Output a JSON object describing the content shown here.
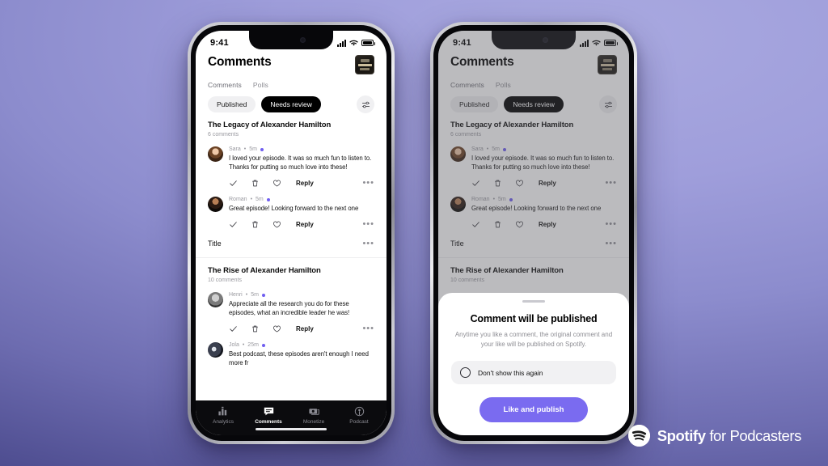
{
  "background": {
    "gradient_from": "#a9a9e0",
    "gradient_to": "#4b4a8d"
  },
  "brand": {
    "logo_mark": "spotify-icon",
    "name_bold": "Spotify",
    "name_rest": " for Podcasters",
    "accent": "#7a6bf0"
  },
  "status_bar": {
    "time": "9:41",
    "signal_icon": "cellular-bars-icon",
    "wifi_icon": "wifi-icon",
    "battery_icon": "battery-full-icon"
  },
  "header": {
    "title": "Comments",
    "cover_art": "podcast-cover-art"
  },
  "tabs": [
    {
      "label": "Comments",
      "active": true
    },
    {
      "label": "Polls",
      "active": false
    }
  ],
  "filters": {
    "chips": [
      {
        "label": "Published",
        "selected": false
      },
      {
        "label": "Needs review",
        "selected": true
      }
    ],
    "filter_icon": "sliders-filter-icon"
  },
  "episodes": [
    {
      "title": "The Legacy of Alexander Hamilton",
      "count": "6 comments",
      "comments": [
        {
          "avatar": "av-sara",
          "author": "Sara",
          "time": "5m",
          "meta_sep": "•",
          "text": "I loved your episode. It was so much fun to listen to. Thanks for putting so much love into these!",
          "actions": {
            "approve_icon": "check-icon",
            "delete_icon": "trash-icon",
            "like_icon": "heart-icon",
            "reply_label": "Reply",
            "more_icon": "more-horizontal-icon",
            "more_glyph": "•••"
          }
        },
        {
          "avatar": "av-roman",
          "author": "Roman",
          "time": "5m",
          "meta_sep": "•",
          "text": "Great episode! Looking forward to the next one",
          "actions": {
            "approve_icon": "check-icon",
            "delete_icon": "trash-icon",
            "like_icon": "heart-icon",
            "reply_label": "Reply",
            "more_icon": "more-horizontal-icon",
            "more_glyph": "•••"
          }
        }
      ]
    },
    {
      "title": "The Rise of Alexander Hamilton",
      "count": "10 comments",
      "comments": [
        {
          "avatar": "av-henri",
          "author": "Henri",
          "time": "5m",
          "meta_sep": "•",
          "text": "Appreciate all the research you do for these episodes, what an incredible leader he was!",
          "actions": {
            "approve_icon": "check-icon",
            "delete_icon": "trash-icon",
            "like_icon": "heart-icon",
            "reply_label": "Reply",
            "more_icon": "more-horizontal-icon",
            "more_glyph": "•••"
          }
        },
        {
          "avatar": "av-jola",
          "author": "Jola",
          "time": "25m",
          "meta_sep": "•",
          "text": "Best podcast, these episodes aren't enough I need more fr",
          "actions": {
            "approve_icon": "check-icon",
            "delete_icon": "trash-icon",
            "like_icon": "heart-icon",
            "reply_label": "Reply",
            "more_icon": "more-horizontal-icon",
            "more_glyph": "•••"
          }
        }
      ]
    }
  ],
  "title_row": {
    "label": "Title",
    "more_glyph": "•••"
  },
  "bottom_nav": [
    {
      "label": "Analytics",
      "icon": "bar-chart-icon",
      "active": false
    },
    {
      "label": "Comments",
      "icon": "comment-bubble-icon",
      "active": true
    },
    {
      "label": "Monetize",
      "icon": "money-icon",
      "active": false
    },
    {
      "label": "Podcast",
      "icon": "microphone-broadcast-icon",
      "active": false
    }
  ],
  "modal": {
    "title": "Comment will be published",
    "body": "Anytime you like a comment, the original comment and your like will be published on Spotify.",
    "option_label": "Don't show this again",
    "cta_label": "Like and publish",
    "cta_color": "#7a6bf0"
  }
}
